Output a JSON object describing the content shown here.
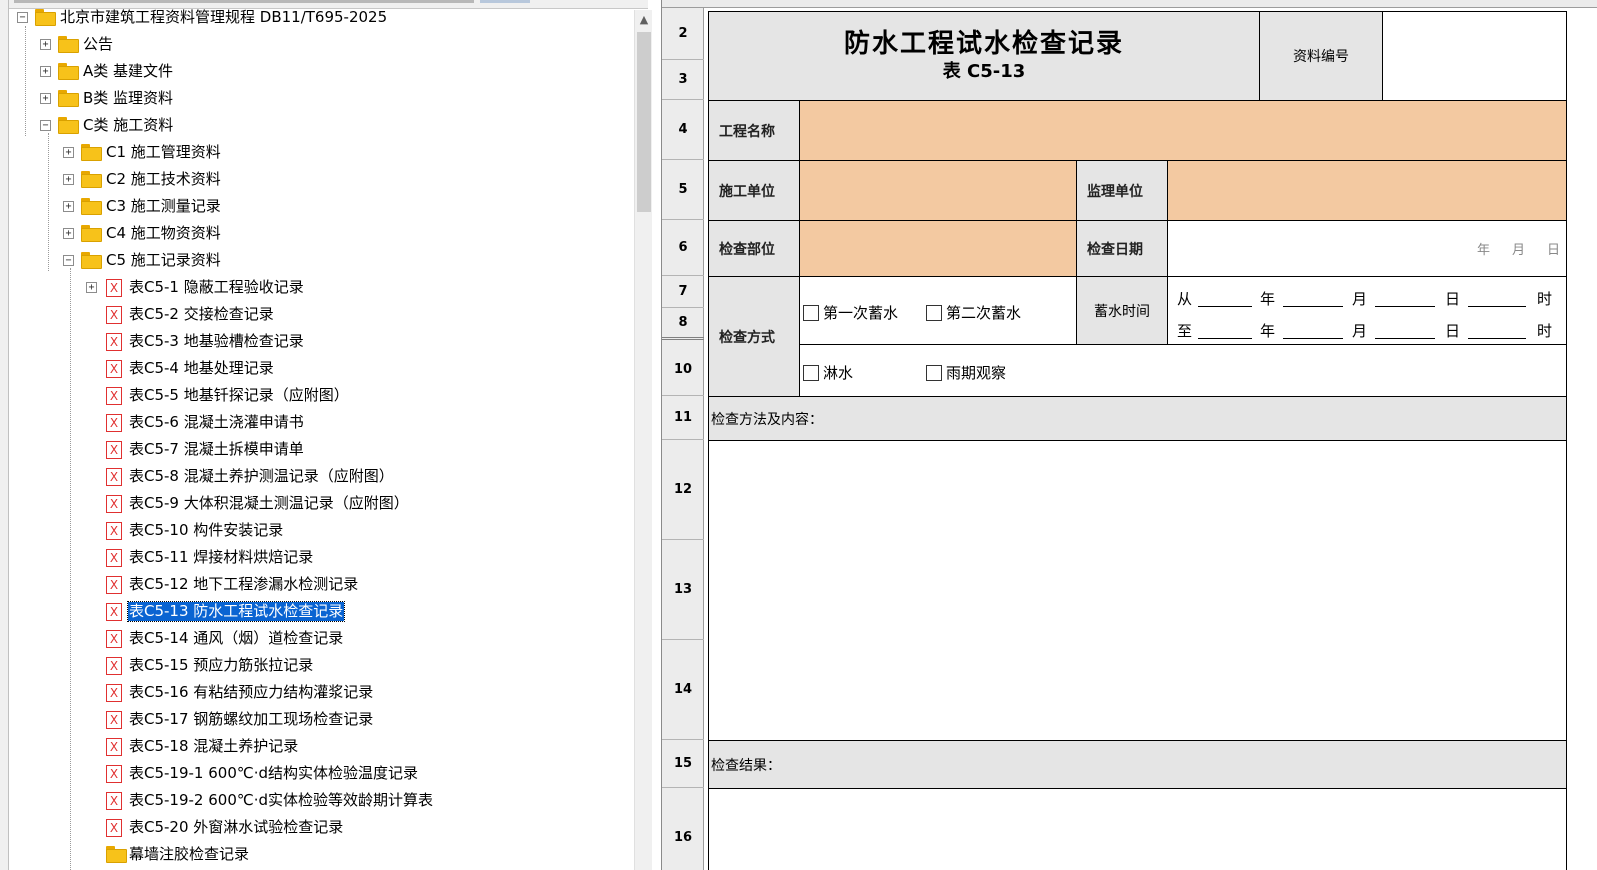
{
  "tree": {
    "root": "北京市建筑工程资料管理规程 DB11/T695-2025",
    "items": [
      {
        "label": "公告"
      },
      {
        "label": "A类 基建文件"
      },
      {
        "label": "B类 监理资料"
      },
      {
        "label": "C类 施工资料"
      },
      {
        "label": "C1 施工管理资料"
      },
      {
        "label": "C2 施工技术资料"
      },
      {
        "label": "C3 施工测量记录"
      },
      {
        "label": "C4 施工物资资料"
      },
      {
        "label": "C5 施工记录资料"
      }
    ],
    "forms": [
      {
        "label": "表C5-1 隐蔽工程验收记录"
      },
      {
        "label": "表C5-2 交接检查记录"
      },
      {
        "label": "表C5-3 地基验槽检查记录"
      },
      {
        "label": "表C5-4 地基处理记录"
      },
      {
        "label": "表C5-5 地基钎探记录（应附图）"
      },
      {
        "label": "表C5-6 混凝土浇灌申请书"
      },
      {
        "label": "表C5-7 混凝土拆模申请单"
      },
      {
        "label": "表C5-8 混凝土养护测温记录（应附图）"
      },
      {
        "label": "表C5-9 大体积混凝土测温记录（应附图）"
      },
      {
        "label": "表C5-10 构件安装记录"
      },
      {
        "label": "表C5-11 焊接材料烘焙记录"
      },
      {
        "label": "表C5-12 地下工程渗漏水检测记录"
      },
      {
        "label": "表C5-13 防水工程试水检查记录"
      },
      {
        "label": "表C5-14 通风（烟）道检查记录"
      },
      {
        "label": "表C5-15 预应力筋张拉记录"
      },
      {
        "label": "表C5-16 有粘结预应力结构灌浆记录"
      },
      {
        "label": "表C5-17 钢筋螺纹加工现场检查记录"
      },
      {
        "label": "表C5-18 混凝土养护记录"
      },
      {
        "label": "表C5-19-1 600℃·d结构实体检验温度记录"
      },
      {
        "label": "表C5-19-2 600℃·d实体检验等效龄期计算表"
      },
      {
        "label": "表C5-20 外窗淋水试验检查记录"
      },
      {
        "label": "幕墙注胶检查记录"
      }
    ],
    "toggle_plus": "+",
    "toggle_minus": "−",
    "xls_glyph": "X"
  },
  "scrollbar": {
    "up_arrow": "▲"
  },
  "sheet": {
    "row_numbers": [
      "2",
      "3",
      "4",
      "5",
      "6",
      "7",
      "8",
      "10",
      "11",
      "12",
      "13",
      "14",
      "15",
      "16"
    ],
    "title": "防水工程试水检查记录",
    "subtitle": "表 C5-13",
    "doc_no_label": "资料编号",
    "doc_no_value": "",
    "project_name_label": "工程名称",
    "contractor_label": "施工单位",
    "supervisor_label": "监理单位",
    "inspect_part_label": "检查部位",
    "inspect_date_label": "检查日期",
    "date_units": {
      "year": "年",
      "month": "月",
      "day": "日"
    },
    "method_label": "检查方式",
    "options": {
      "first_storage": "第一次蓄水",
      "second_storage": "第二次蓄水",
      "sprinkle": "淋水",
      "rain_observe": "雨期观察"
    },
    "storage_time_label": "蓄水时间",
    "from_label": "从",
    "to_label": "至",
    "time_units": {
      "year": "年",
      "month": "月",
      "day": "日",
      "hour": "时"
    },
    "method_content_label": "检查方法及内容：",
    "result_label": "检查结果："
  },
  "colors": {
    "gray": "#e5e5e5",
    "peach": "#f3c9a1",
    "selection": "#0a64d2"
  }
}
